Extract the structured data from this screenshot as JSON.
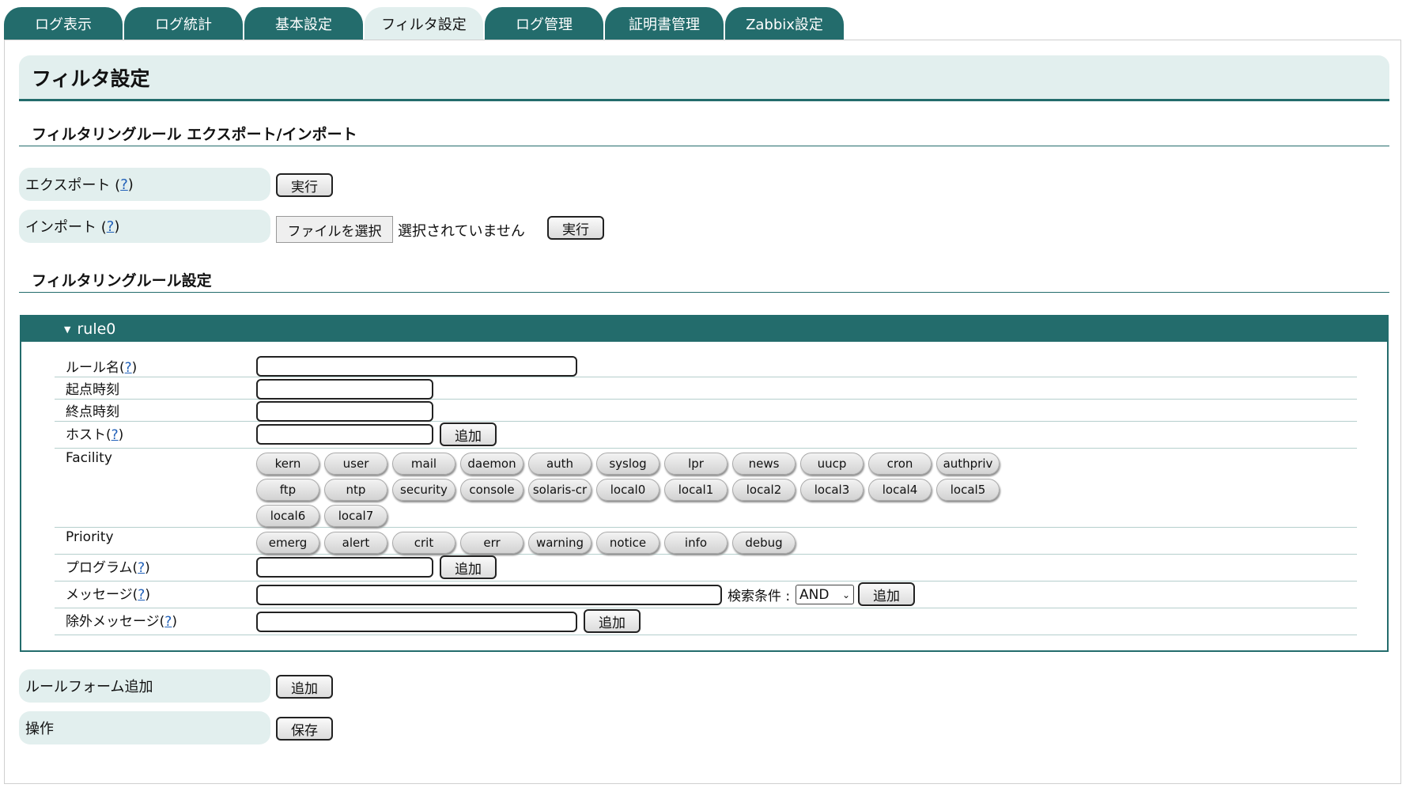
{
  "tabs": [
    {
      "label": "ログ表示"
    },
    {
      "label": "ログ統計"
    },
    {
      "label": "基本設定"
    },
    {
      "label": "フィルタ設定"
    },
    {
      "label": "ログ管理"
    },
    {
      "label": "証明書管理"
    },
    {
      "label": "Zabbix設定"
    }
  ],
  "active_tab": "フィルタ設定",
  "page_title": "フィルタ設定",
  "export_import": {
    "heading": "フィルタリングルール エクスポート/インポート",
    "export_label": "エクスポート (",
    "import_label": "インポート (",
    "help_mark": "?",
    "close_paren": ")",
    "run_label": "実行",
    "file_button": "ファイルを選択",
    "file_status": "選択されていません"
  },
  "rules_heading": "フィルタリングルール設定",
  "rule": {
    "title": "rule0",
    "fields": {
      "rule_name": "ルール名(",
      "start_time": "起点時刻",
      "end_time": "終点時刻",
      "host": "ホスト(",
      "facility": "Facility",
      "priority": "Priority",
      "program": "プログラム(",
      "message": "メッセージ(",
      "exclude_message": "除外メッセージ("
    },
    "add_label": "追加",
    "search_cond_label": "検索条件 :",
    "search_cond_value": "AND",
    "facilities": [
      "kern",
      "user",
      "mail",
      "daemon",
      "auth",
      "syslog",
      "lpr",
      "news",
      "uucp",
      "cron",
      "authpriv",
      "ftp",
      "ntp",
      "security",
      "console",
      "solaris-cr",
      "local0",
      "local1",
      "local2",
      "local3",
      "local4",
      "local5",
      "local6",
      "local7"
    ],
    "priorities": [
      "emerg",
      "alert",
      "crit",
      "err",
      "warning",
      "notice",
      "info",
      "debug"
    ]
  },
  "rule_form_add": {
    "label": "ルールフォーム追加",
    "button": "追加"
  },
  "operation": {
    "label": "操作",
    "button": "保存"
  }
}
